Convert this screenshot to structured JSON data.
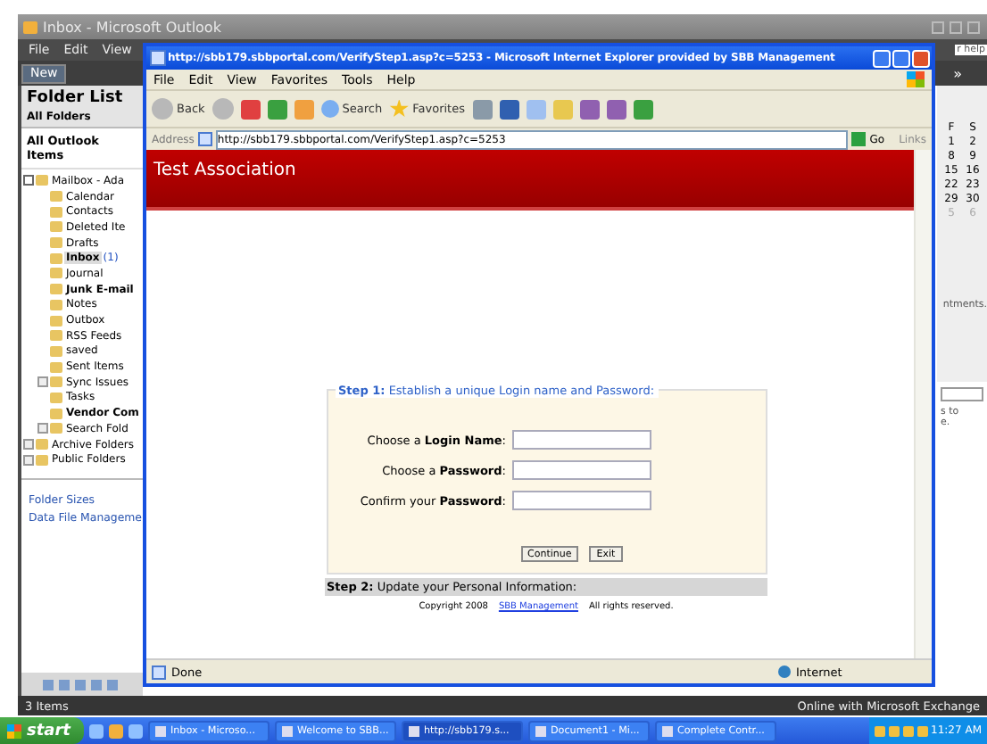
{
  "outlook": {
    "title": "Inbox - Microsoft Outlook",
    "menu": [
      "File",
      "Edit",
      "View"
    ],
    "new_button": "New",
    "help_box": "r help",
    "right_toolbar": "»",
    "calendar": {
      "headers": [
        "F",
        "S"
      ],
      "rows": [
        [
          "1",
          "2"
        ],
        [
          "8",
          "9"
        ],
        [
          "15",
          "16"
        ],
        [
          "22",
          "23"
        ],
        [
          "29",
          "30"
        ],
        [
          "5",
          "6"
        ]
      ]
    },
    "right_fragments": [
      "ntments.",
      "s to",
      "e."
    ],
    "folder_list": {
      "title": "Folder List",
      "subtitle": "All Folders",
      "all_items": "All Outlook Items",
      "tree": [
        {
          "label": "Mailbox - Ada",
          "expanded": true,
          "unread": false,
          "selected": false,
          "children": [
            {
              "label": "Calendar",
              "unread": false,
              "selected": false
            },
            {
              "label": "Contacts",
              "unread": false,
              "selected": false
            },
            {
              "label": "Deleted Ite",
              "unread": false,
              "selected": false
            },
            {
              "label": "Drafts",
              "unread": false,
              "selected": false
            },
            {
              "label": "Inbox",
              "count": "(1)",
              "unread": true,
              "selected": true
            },
            {
              "label": "Journal",
              "unread": false,
              "selected": false
            },
            {
              "label": "Junk E-mail",
              "unread": true,
              "selected": false
            },
            {
              "label": "Notes",
              "unread": false,
              "selected": false
            },
            {
              "label": "Outbox",
              "unread": false,
              "selected": false
            },
            {
              "label": "RSS Feeds",
              "unread": false,
              "selected": false
            },
            {
              "label": "saved",
              "unread": false,
              "selected": false
            },
            {
              "label": "Sent Items",
              "unread": false,
              "selected": false
            },
            {
              "label": "Sync Issues",
              "expanded": false,
              "unread": false,
              "selected": false
            },
            {
              "label": "Tasks",
              "unread": false,
              "selected": false
            },
            {
              "label": "Vendor Com",
              "unread": true,
              "selected": false
            },
            {
              "label": "Search Fold",
              "expanded": false,
              "unread": false,
              "selected": false
            }
          ]
        },
        {
          "label": "Archive Folders",
          "expanded": false,
          "unread": false,
          "selected": false
        },
        {
          "label": "Public Folders",
          "expanded": false,
          "unread": false,
          "selected": false
        }
      ],
      "links": [
        "Folder Sizes",
        "Data File Manageme"
      ]
    },
    "status_left": "3 Items",
    "status_right": "Online with Microsoft Exchange"
  },
  "browser": {
    "title": "http://sbb179.sbbportal.com/VerifyStep1.asp?c=5253 - Microsoft Internet Explorer provided by SBB Management",
    "menu": [
      "File",
      "Edit",
      "View",
      "Favorites",
      "Tools",
      "Help"
    ],
    "back": "Back",
    "search": "Search",
    "favorites": "Favorites",
    "address_label": "Address",
    "url": "http://sbb179.sbbportal.com/VerifyStep1.asp?c=5253",
    "go": "Go",
    "links": "Links",
    "page": {
      "header": "Test Association",
      "step1": "**Step 1:** Establish a unique Login name and Password:",
      "fields": [
        {
          "label": "Choose a **Login Name**:"
        },
        {
          "label": "Choose a **Password**:"
        },
        {
          "label": "Confirm your **Password**:"
        }
      ],
      "buttons": [
        "Continue",
        "Exit"
      ],
      "step2": "**Step 2:** Update your Personal Information:",
      "copyright": "Copyright 2008",
      "copyright_link": "SBB Management",
      "rights": "All rights reserved."
    },
    "status": "Done",
    "zone": "Internet"
  },
  "taskbar": {
    "start": "start",
    "tasks": [
      {
        "label": "Inbox - Microso...",
        "selected": false
      },
      {
        "label": "Welcome to SBB...",
        "selected": false
      },
      {
        "label": "http://sbb179.s...",
        "selected": true
      },
      {
        "label": "Document1 - Mi...",
        "selected": false
      },
      {
        "label": "Complete Contr...",
        "selected": false
      }
    ],
    "clock": "11:27 AM"
  }
}
